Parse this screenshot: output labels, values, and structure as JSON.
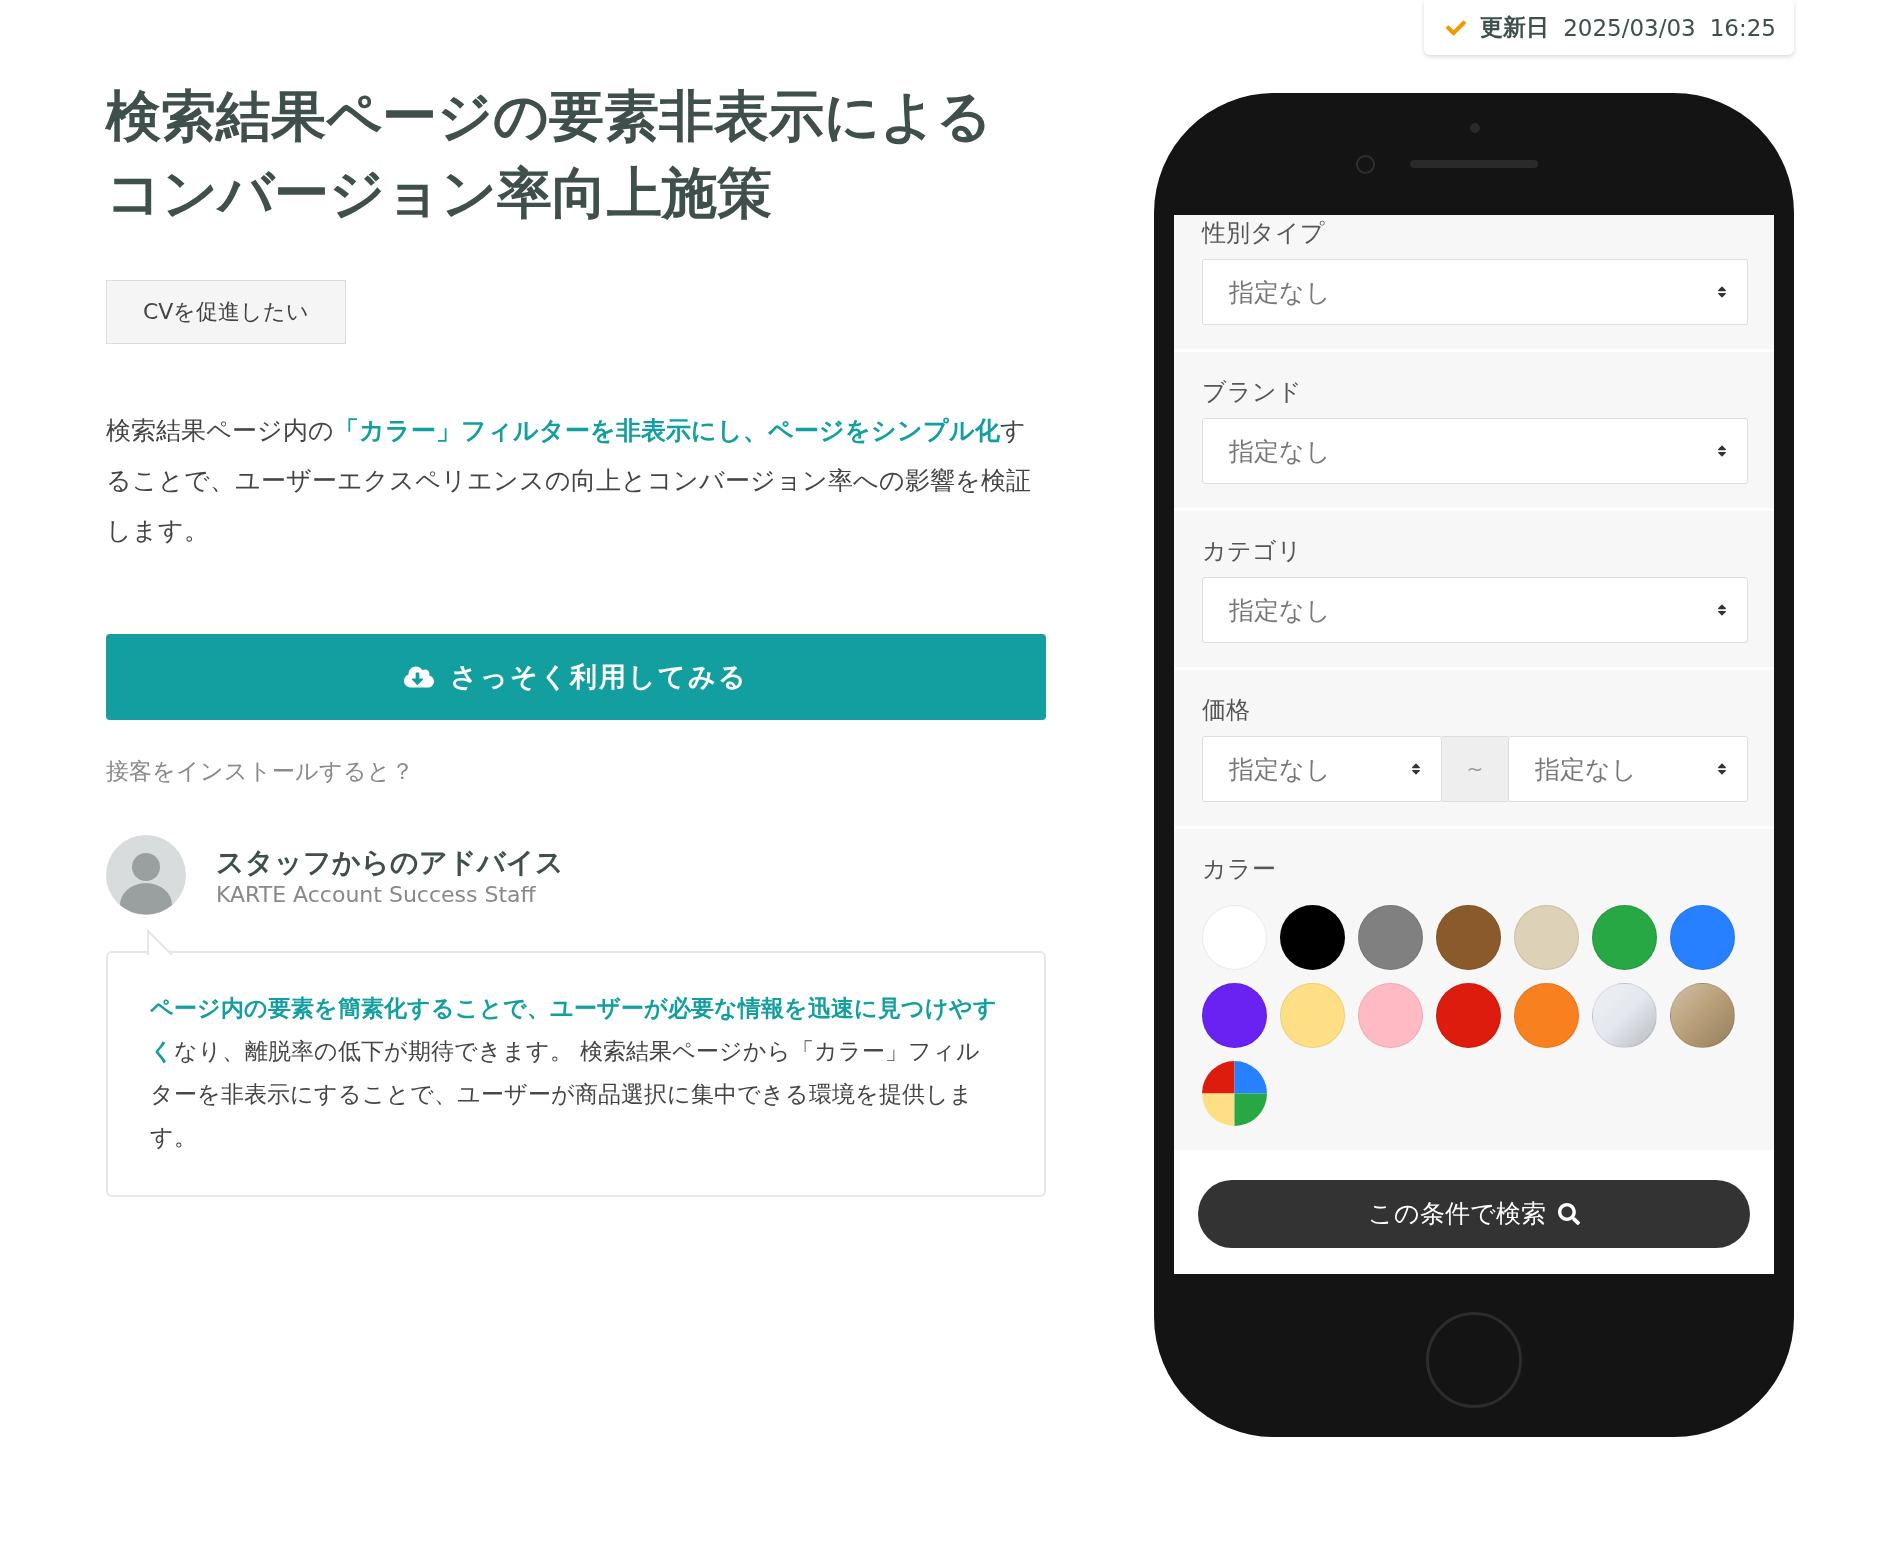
{
  "update_badge": {
    "label": "更新日",
    "date": "2025/03/03",
    "time": "16:25"
  },
  "title_lines": [
    "検索結果ページの要素非表示による",
    "コンバージョン率向上施策"
  ],
  "tag": "CVを促進したい",
  "description": "検索結果ページ内の**「カラー」フィルターを非表示にし、ページをシンプル化**することで、ユーザーエクスペリエンスの向上とコンバージョン率への影響を検証します。",
  "cta_button": "さっそく利用してみる",
  "install_link": "接客をインストールすると？",
  "advice": {
    "heading": "スタッフからのアドバイス",
    "subtitle": "KARTE Account Success Staff",
    "text": "**ページ内の要素を簡素化することで、ユーザーが必要な情報を迅速に見つけやすく**なり、離脱率の低下が期待できます。 検索結果ページから「カラー」フィルターを非表示にすることで、ユーザーが商品選択に集中できる環境を提供します。"
  },
  "phone": {
    "filters": [
      {
        "kind": "select",
        "label": "性別タイプ",
        "value": "指定なし"
      },
      {
        "kind": "select",
        "label": "ブランド",
        "value": "指定なし"
      },
      {
        "kind": "select",
        "label": "カテゴリ",
        "value": "指定なし"
      },
      {
        "kind": "range",
        "label": "価格",
        "from": "指定なし",
        "separator": "~",
        "to": "指定なし"
      },
      {
        "kind": "colors",
        "label": "カラー",
        "swatches": [
          {
            "kind": "solid",
            "color": "#ffffff"
          },
          {
            "kind": "solid",
            "color": "#000000"
          },
          {
            "kind": "solid",
            "color": "#808080"
          },
          {
            "kind": "solid",
            "color": "#8b5a2b"
          },
          {
            "kind": "solid",
            "color": "#ddd1b7"
          },
          {
            "kind": "solid",
            "color": "#28a745"
          },
          {
            "kind": "solid",
            "color": "#2680ff"
          },
          {
            "kind": "solid",
            "color": "#6a22f2"
          },
          {
            "kind": "solid",
            "color": "#ffdf86"
          },
          {
            "kind": "solid",
            "color": "#ffbac4"
          },
          {
            "kind": "solid",
            "color": "#dd1c0e"
          },
          {
            "kind": "solid",
            "color": "#f8801e"
          },
          {
            "kind": "gradient",
            "color": "#e4e8ee"
          },
          {
            "kind": "gradient",
            "color": "#b89e77"
          },
          {
            "kind": "multi"
          }
        ]
      }
    ],
    "search_button": "この条件で検索"
  }
}
